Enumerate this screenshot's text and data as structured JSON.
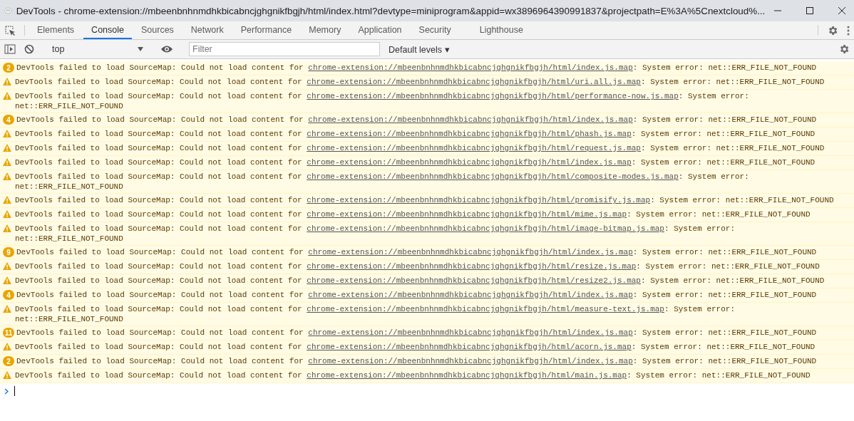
{
  "window": {
    "title": "DevTools - chrome-extension://mbeenbnhnmdhkbicabncjghgnikfbgjh/html/index.html?devtype=miniprogram&appid=wx3896964390991837&projectpath=E%3A%5Cnextcloud%..."
  },
  "tabs": [
    {
      "label": "Elements",
      "selected": false
    },
    {
      "label": "Console",
      "selected": true
    },
    {
      "label": "Sources",
      "selected": false
    },
    {
      "label": "Network",
      "selected": false
    },
    {
      "label": "Performance",
      "selected": false
    },
    {
      "label": "Memory",
      "selected": false
    },
    {
      "label": "Application",
      "selected": false
    },
    {
      "label": "Security",
      "selected": false
    },
    {
      "label": "Lighthouse",
      "selected": false
    }
  ],
  "toolbar": {
    "context": "top",
    "filter": {
      "placeholder": "Filter"
    },
    "levels": "Default levels ▾"
  },
  "messages": [
    {
      "kind": "count",
      "count": "2",
      "text": "DevTools failed to load SourceMap: Could not load content for ",
      "link": "chrome-extension://mbeenbnhnmdhkbicabncjghgnikfbgjh/html/index.js.map",
      "suffix": ": System error: net::ERR_FILE_NOT_FOUND"
    },
    {
      "kind": "warning",
      "text": "DevTools failed to load SourceMap: Could not load content for ",
      "link": "chrome-extension://mbeenbnhnmdhkbicabncjghgnikfbgjh/html/uri.all.js.map",
      "suffix": ": System error: net::ERR_FILE_NOT_FOUND"
    },
    {
      "kind": "warning",
      "text": "DevTools failed to load SourceMap: Could not load content for ",
      "link": "chrome-extension://mbeenbnhnmdhkbicabncjghgnikfbgjh/html/performance-now.js.map",
      "suffix": ": System error: net::ERR_FILE_NOT_FOUND"
    },
    {
      "kind": "count",
      "count": "4",
      "text": "DevTools failed to load SourceMap: Could not load content for ",
      "link": "chrome-extension://mbeenbnhnmdhkbicabncjghgnikfbgjh/html/index.js.map",
      "suffix": ": System error: net::ERR_FILE_NOT_FOUND"
    },
    {
      "kind": "warning",
      "text": "DevTools failed to load SourceMap: Could not load content for ",
      "link": "chrome-extension://mbeenbnhnmdhkbicabncjghgnikfbgjh/html/phash.js.map",
      "suffix": ": System error: net::ERR_FILE_NOT_FOUND"
    },
    {
      "kind": "warning",
      "text": "DevTools failed to load SourceMap: Could not load content for ",
      "link": "chrome-extension://mbeenbnhnmdhkbicabncjghgnikfbgjh/html/request.js.map",
      "suffix": ": System error: net::ERR_FILE_NOT_FOUND"
    },
    {
      "kind": "warning",
      "text": "DevTools failed to load SourceMap: Could not load content for ",
      "link": "chrome-extension://mbeenbnhnmdhkbicabncjghgnikfbgjh/html/index.js.map",
      "suffix": ": System error: net::ERR_FILE_NOT_FOUND"
    },
    {
      "kind": "warning",
      "text": "DevTools failed to load SourceMap: Could not load content for ",
      "link": "chrome-extension://mbeenbnhnmdhkbicabncjghgnikfbgjh/html/composite-modes.js.map",
      "suffix": ": System error: net::ERR_FILE_NOT_FOUND"
    },
    {
      "kind": "warning",
      "text": "DevTools failed to load SourceMap: Could not load content for ",
      "link": "chrome-extension://mbeenbnhnmdhkbicabncjghgnikfbgjh/html/promisify.js.map",
      "suffix": ": System error: net::ERR_FILE_NOT_FOUND"
    },
    {
      "kind": "warning",
      "text": "DevTools failed to load SourceMap: Could not load content for ",
      "link": "chrome-extension://mbeenbnhnmdhkbicabncjghgnikfbgjh/html/mime.js.map",
      "suffix": ": System error: net::ERR_FILE_NOT_FOUND"
    },
    {
      "kind": "warning",
      "text": "DevTools failed to load SourceMap: Could not load content for ",
      "link": "chrome-extension://mbeenbnhnmdhkbicabncjghgnikfbgjh/html/image-bitmap.js.map",
      "suffix": ": System error: net::ERR_FILE_NOT_FOUND"
    },
    {
      "kind": "count",
      "count": "9",
      "text": "DevTools failed to load SourceMap: Could not load content for ",
      "link": "chrome-extension://mbeenbnhnmdhkbicabncjghgnikfbgjh/html/index.js.map",
      "suffix": ": System error: net::ERR_FILE_NOT_FOUND"
    },
    {
      "kind": "warning",
      "text": "DevTools failed to load SourceMap: Could not load content for ",
      "link": "chrome-extension://mbeenbnhnmdhkbicabncjghgnikfbgjh/html/resize.js.map",
      "suffix": ": System error: net::ERR_FILE_NOT_FOUND"
    },
    {
      "kind": "warning",
      "text": "DevTools failed to load SourceMap: Could not load content for ",
      "link": "chrome-extension://mbeenbnhnmdhkbicabncjghgnikfbgjh/html/resize2.js.map",
      "suffix": ": System error: net::ERR_FILE_NOT_FOUND"
    },
    {
      "kind": "count",
      "count": "4",
      "text": "DevTools failed to load SourceMap: Could not load content for ",
      "link": "chrome-extension://mbeenbnhnmdhkbicabncjghgnikfbgjh/html/index.js.map",
      "suffix": ": System error: net::ERR_FILE_NOT_FOUND"
    },
    {
      "kind": "warning",
      "text": "DevTools failed to load SourceMap: Could not load content for ",
      "link": "chrome-extension://mbeenbnhnmdhkbicabncjghgnikfbgjh/html/measure-text.js.map",
      "suffix": ": System error: net::ERR_FILE_NOT_FOUND"
    },
    {
      "kind": "count",
      "count": "11",
      "text": "DevTools failed to load SourceMap: Could not load content for ",
      "link": "chrome-extension://mbeenbnhnmdhkbicabncjghgnikfbgjh/html/index.js.map",
      "suffix": ": System error: net::ERR_FILE_NOT_FOUND"
    },
    {
      "kind": "warning",
      "text": "DevTools failed to load SourceMap: Could not load content for ",
      "link": "chrome-extension://mbeenbnhnmdhkbicabncjghgnikfbgjh/html/acorn.js.map",
      "suffix": ": System error: net::ERR_FILE_NOT_FOUND"
    },
    {
      "kind": "count",
      "count": "2",
      "text": "DevTools failed to load SourceMap: Could not load content for ",
      "link": "chrome-extension://mbeenbnhnmdhkbicabncjghgnikfbgjh/html/index.js.map",
      "suffix": ": System error: net::ERR_FILE_NOT_FOUND"
    },
    {
      "kind": "warning",
      "text": "DevTools failed to load SourceMap: Could not load content for ",
      "link": "chrome-extension://mbeenbnhnmdhkbicabncjghgnikfbgjh/html/main.js.map",
      "suffix": ": System error: net::ERR_FILE_NOT_FOUND"
    }
  ]
}
